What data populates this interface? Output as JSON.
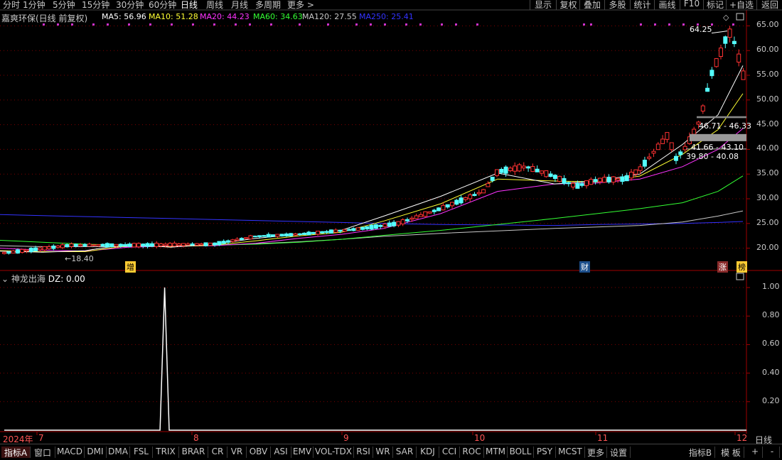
{
  "top_periods": [
    {
      "label": "分时",
      "x": 4
    },
    {
      "label": "1分钟",
      "x": 32
    },
    {
      "label": "5分钟",
      "x": 74
    },
    {
      "label": "15分钟",
      "x": 115
    },
    {
      "label": "30分钟",
      "x": 163
    },
    {
      "label": "60分钟",
      "x": 209
    },
    {
      "label": "日线",
      "x": 254,
      "active": true
    },
    {
      "label": "周线",
      "x": 290
    },
    {
      "label": "月线",
      "x": 325
    },
    {
      "label": "多周期",
      "x": 359
    },
    {
      "label": "更多 >",
      "x": 404
    }
  ],
  "top_buttons": [
    "显示",
    "复权",
    "叠加",
    "多股",
    "统计",
    "画线",
    "F10",
    "标记",
    "+自选",
    "返回"
  ],
  "header": {
    "stock": "嘉爽环保(日线 前复权)",
    "ma": [
      {
        "label": "MA5: 56.96",
        "color": "#ffffff"
      },
      {
        "label": "MA10: 51.28",
        "color": "#ffff33"
      },
      {
        "label": "MA20: 44.23",
        "color": "#ff33ff"
      },
      {
        "label": "MA60: 34.63",
        "color": "#33ff33"
      },
      {
        "label": "MA120: 27.55",
        "color": "#c8c8c8"
      },
      {
        "label": "MA250: 25.41",
        "color": "#3333ff"
      }
    ]
  },
  "chart_data": [
    {
      "type": "candlestick",
      "title": "嘉爽环保(日线 前复权)",
      "ylim": [
        17.5,
        66.5
      ],
      "yticks": [
        20,
        25,
        30,
        35,
        40,
        45,
        50,
        55,
        60,
        65
      ],
      "annotations": [
        {
          "text": "64.25",
          "kind": "high"
        },
        {
          "text": "18.40",
          "kind": "low"
        },
        {
          "text": "46.71 - 46.33",
          "kind": "zone"
        },
        {
          "text": "41.66 - 43.10",
          "kind": "zone"
        },
        {
          "text": "39.80 - 40.08",
          "kind": "zone"
        }
      ],
      "markers": [
        {
          "text": "增"
        },
        {
          "text": "财"
        },
        {
          "text": "涨"
        },
        {
          "text": "榜"
        }
      ],
      "series": [
        {
          "name": "MA250",
          "color": "#3333ff",
          "values": [
            26.8,
            26.6,
            26.4,
            26.2,
            26.0,
            25.8,
            25.6,
            25.4,
            25.2,
            25.0,
            24.8,
            24.7,
            24.6,
            24.8,
            24.9,
            25.0,
            25.2,
            25.41
          ]
        },
        {
          "name": "MA120",
          "color": "#c8c8c8",
          "values": [
            20.5,
            20.3,
            20.3,
            20.3,
            20.4,
            20.6,
            20.9,
            21.3,
            21.8,
            22.4,
            23.0,
            23.5,
            24.0,
            24.3,
            24.6,
            25.3,
            26.5,
            27.55
          ]
        },
        {
          "name": "MA60",
          "color": "#33ff33",
          "values": [
            21.6,
            21.2,
            20.8,
            20.6,
            20.6,
            20.6,
            20.8,
            21.2,
            21.8,
            22.6,
            23.6,
            24.8,
            26.0,
            27.0,
            28.0,
            29.2,
            31.5,
            34.63
          ]
        },
        {
          "name": "MA20",
          "color": "#ff33ff",
          "values": [
            20.0,
            19.6,
            19.4,
            20.2,
            20.4,
            20.5,
            21.0,
            22.0,
            22.8,
            24.0,
            27.0,
            31.5,
            33.0,
            33.2,
            34.0,
            36.5,
            40.0,
            44.23
          ]
        },
        {
          "name": "MA10",
          "color": "#ffff33",
          "values": [
            19.5,
            19.3,
            19.3,
            20.5,
            20.3,
            20.6,
            21.5,
            22.5,
            23.2,
            25.5,
            29.0,
            34.0,
            33.6,
            33.4,
            34.6,
            39.0,
            44.0,
            51.28
          ]
        },
        {
          "name": "MA5",
          "color": "#ffffff",
          "values": [
            19.4,
            19.2,
            19.5,
            20.8,
            20.2,
            20.8,
            22.0,
            22.8,
            23.6,
            26.5,
            30.5,
            35.2,
            33.0,
            33.6,
            35.0,
            41.0,
            47.0,
            56.96
          ]
        }
      ]
    },
    {
      "type": "line",
      "title": "神龙出海",
      "legend": "DZ: 0.00",
      "ylim": [
        0,
        1.05
      ],
      "yticks": [
        "1.00",
        "0.80",
        "0.60",
        "0.40",
        "0.20"
      ],
      "x_axis": [
        "2024年",
        "7",
        "8",
        "9",
        "10",
        "11",
        "12"
      ],
      "series": [
        {
          "name": "DZ",
          "color": "#ffffff",
          "values": [
            0,
            0,
            0,
            0,
            0,
            0,
            0,
            0,
            0,
            0,
            0,
            0,
            0,
            0,
            0,
            0,
            0,
            0,
            0,
            0,
            0,
            0,
            0,
            0,
            0,
            0,
            0,
            0,
            0,
            0,
            0,
            0,
            0,
            0,
            0,
            1,
            0,
            0,
            0,
            0,
            0,
            0,
            0,
            0,
            0,
            0,
            0,
            0,
            0,
            0,
            0,
            0,
            0,
            0,
            0,
            0,
            0,
            0,
            0,
            0,
            0,
            0,
            0,
            0,
            0,
            0,
            0,
            0,
            0,
            0,
            0,
            0,
            0,
            0,
            0,
            0,
            0,
            0,
            0,
            0,
            0,
            0,
            0,
            0,
            0,
            0,
            0,
            0,
            0,
            0,
            0,
            0,
            0,
            0,
            0,
            0,
            0,
            0,
            0,
            0,
            0,
            0,
            0,
            0,
            0,
            0,
            0,
            0,
            0,
            0,
            0,
            0,
            0,
            0,
            0,
            0,
            0,
            0,
            0,
            0,
            0,
            0,
            0,
            0,
            0,
            0,
            0,
            0,
            0,
            0,
            0,
            0,
            0,
            0,
            0,
            0,
            0,
            0,
            0,
            0,
            0,
            0,
            0,
            0,
            0,
            0,
            0,
            0,
            0,
            0,
            0,
            0,
            0,
            0,
            0,
            0,
            0,
            0,
            0,
            0,
            0,
            0,
            0
          ]
        }
      ]
    }
  ],
  "bottom_tabs": [
    "指标A",
    "窗口",
    "MACD",
    "DMI",
    "DMA",
    "FSL",
    "TRIX",
    "BRAR",
    "CR",
    "VR",
    "OBV",
    "ASI",
    "EMV",
    "VOL-TDX",
    "RSI",
    "WR",
    "SAR",
    "KDJ",
    "CCI",
    "ROC",
    "MTM",
    "BOLL",
    "PSY",
    "MCST",
    "更多",
    "设置"
  ],
  "bottom_right": [
    "指标B",
    "模 板",
    "+",
    "-"
  ],
  "axis_right_label": "日线",
  "colors": {
    "up": "#ff3232",
    "down": "#54ffff",
    "grid": "#800000",
    "border": "#a00000"
  }
}
